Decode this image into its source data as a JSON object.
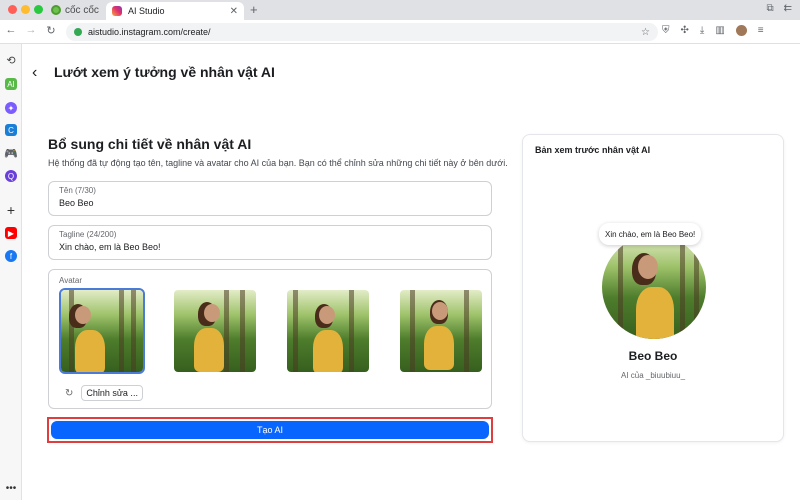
{
  "browser": {
    "brand": "cốc cốc",
    "tab_title": "AI Studio",
    "url": "aistudio.instagram.com/create/"
  },
  "page": {
    "title": "Lướt xem ý tưởng về nhân vật AI",
    "section_title": "Bổ sung chi tiết về nhân vật AI",
    "section_desc": "Hệ thống đã tự động tạo tên, tagline và avatar cho AI của bạn. Bạn có thể chỉnh sửa những chi tiết này ở bên dưới."
  },
  "form": {
    "name_label": "Tên (7/30)",
    "name_value": "Beo Beo",
    "tagline_label": "Tagline (24/200)",
    "tagline_value": "Xin chào, em là Beo Beo!",
    "avatar_label": "Avatar",
    "edit_label": "Chỉnh sửa ...",
    "create_button": "Tạo AI",
    "selected_avatar": 0
  },
  "preview": {
    "title": "Bản xem trước nhân vật AI",
    "bubble": "Xin chào, em là Beo Beo!",
    "name": "Beo Beo",
    "owner": "AI của _biuubiuu_"
  },
  "colors": {
    "primary_button": "#0866ff",
    "highlight_border": "#e03e3e",
    "selected_outline": "#4b7bd8"
  }
}
